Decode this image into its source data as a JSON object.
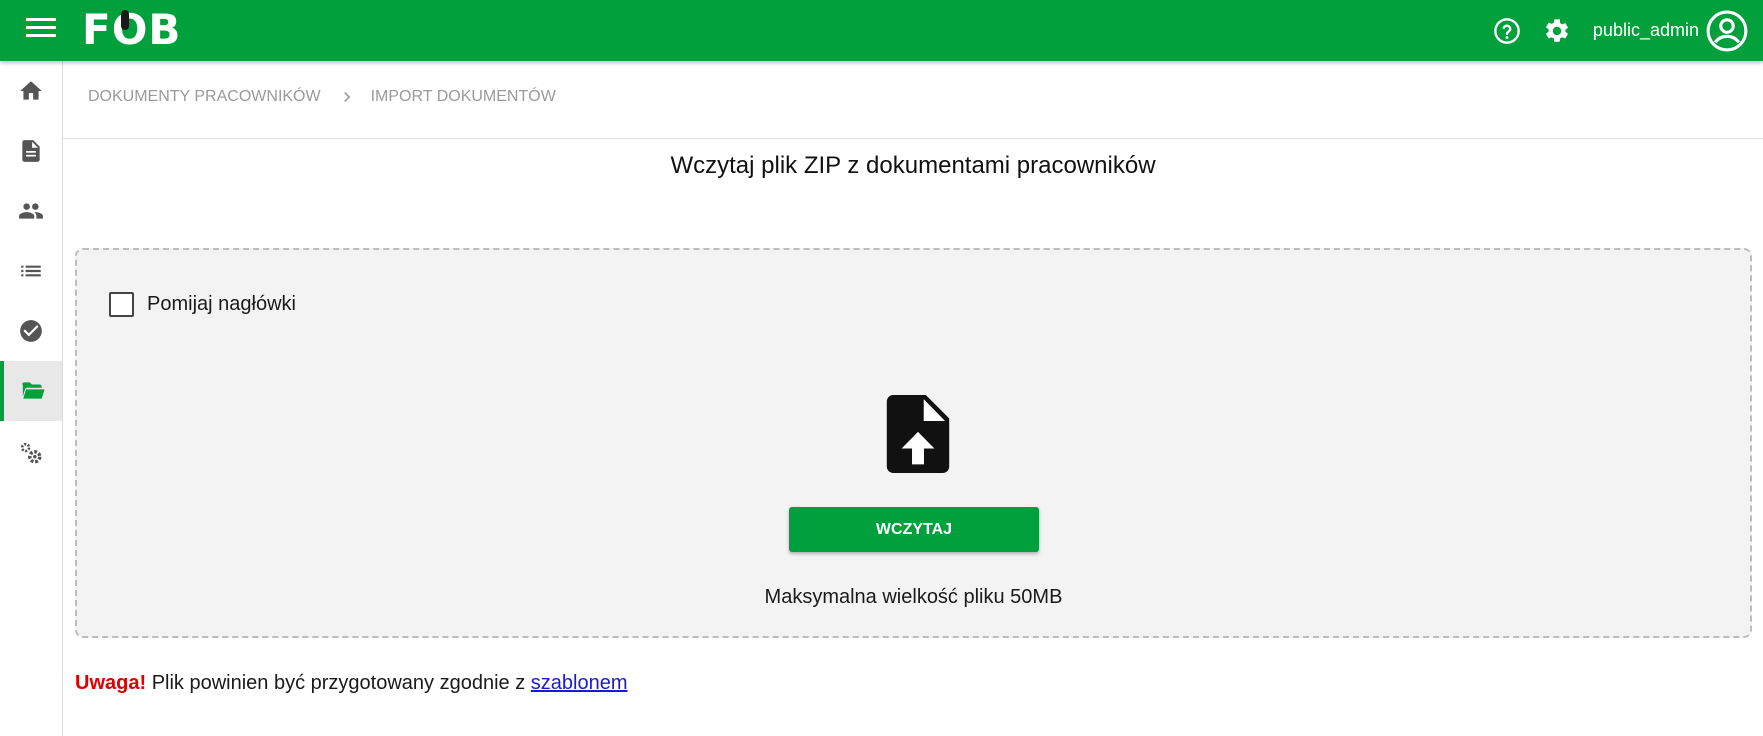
{
  "header": {
    "logo": "FOB",
    "username": "public_admin",
    "icons": [
      "menu-icon",
      "help-icon",
      "gear-icon",
      "account-circle-icon"
    ],
    "color": "#00a03c"
  },
  "sidebar": {
    "items": [
      {
        "icon": "home-icon",
        "active": false
      },
      {
        "icon": "document-icon",
        "active": false
      },
      {
        "icon": "people-icon",
        "active": false
      },
      {
        "icon": "list-icon",
        "active": false
      },
      {
        "icon": "check-circle-icon",
        "active": false
      },
      {
        "icon": "folder-open-icon",
        "active": true
      },
      {
        "icon": "settings-gears-icon",
        "active": false
      }
    ]
  },
  "breadcrumb": {
    "items": [
      "DOKUMENTY PRACOWNIKÓW",
      "IMPORT DOKUMENTÓW"
    ]
  },
  "main": {
    "title": "Wczytaj plik ZIP z dokumentami pracowników",
    "checkbox_label": "Pomijaj nagłówki",
    "checkbox_checked": false,
    "upload_button": "WCZYTAJ",
    "max_size": "Maksymalna wielkość pliku 50MB"
  },
  "warning": {
    "label": "Uwaga!",
    "text": "Plik powinien być przygotowany zgodnie z",
    "link": "szablonem"
  }
}
